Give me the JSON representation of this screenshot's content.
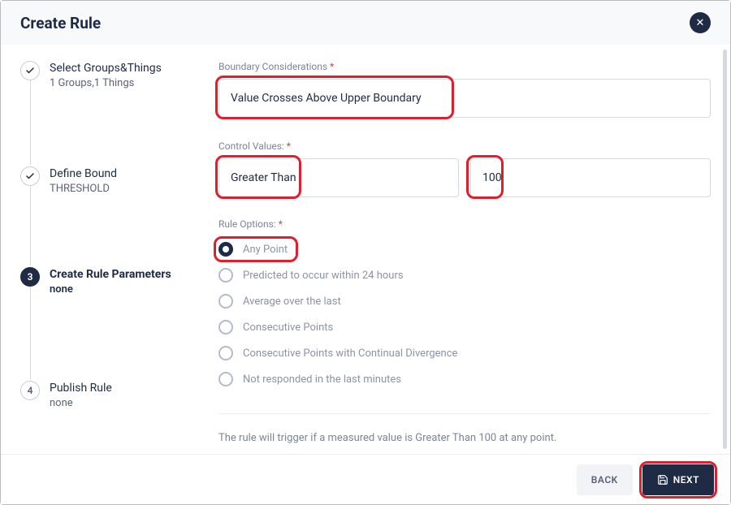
{
  "header": {
    "title": "Create Rule"
  },
  "stepper": {
    "steps": [
      {
        "title": "Select Groups&Things",
        "sub": "1 Groups,1 Things",
        "state": "done"
      },
      {
        "title": "Define Bound",
        "sub": "THRESHOLD",
        "state": "done"
      },
      {
        "title": "Create Rule Parameters",
        "sub": "none",
        "state": "active",
        "num": "3"
      },
      {
        "title": "Publish Rule",
        "sub": "none",
        "state": "future",
        "num": "4"
      }
    ]
  },
  "form": {
    "boundary_label": "Boundary Considerations",
    "boundary_value": "Value Crosses Above Upper Boundary",
    "control_label": "Control Values:",
    "control_operator": "Greater Than",
    "control_value": "100",
    "rule_options_label": "Rule Options:",
    "options": [
      {
        "label": "Any Point",
        "checked": true
      },
      {
        "label": "Predicted to occur within 24 hours",
        "checked": false
      },
      {
        "label": "Average over the last",
        "checked": false
      },
      {
        "label": "Consecutive Points",
        "checked": false
      },
      {
        "label": "Consecutive Points with Continual Divergence",
        "checked": false
      },
      {
        "label": "Not responded in the last minutes",
        "checked": false
      }
    ],
    "hint": "The rule will trigger if a measured value is Greater Than 100 at any point."
  },
  "footer": {
    "back": "BACK",
    "next": "NEXT"
  }
}
